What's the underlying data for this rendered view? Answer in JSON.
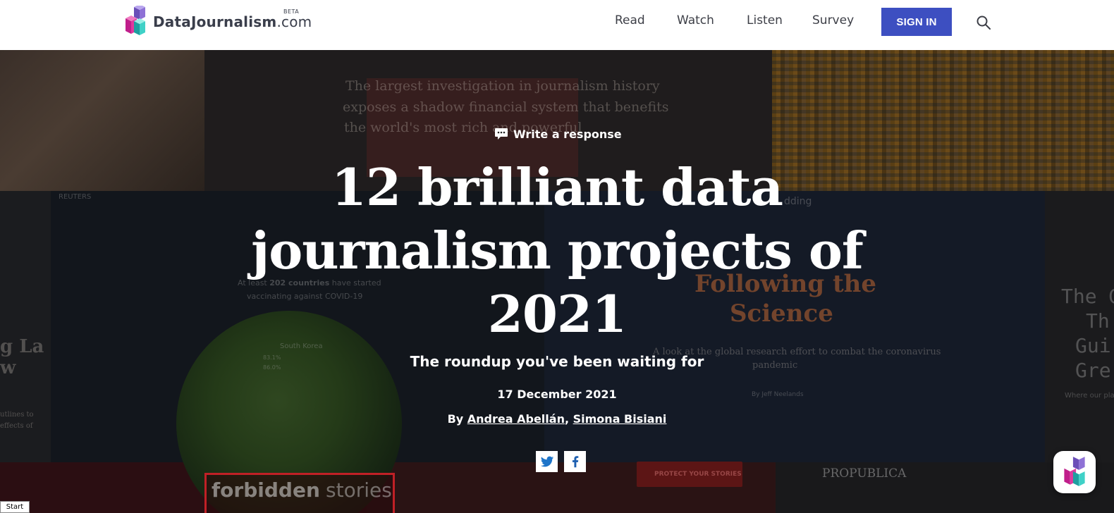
{
  "header": {
    "brand_name": "DataJournalism",
    "brand_suffix": ".com",
    "brand_badge": "BETA",
    "nav": [
      {
        "label": "Read"
      },
      {
        "label": "Watch"
      },
      {
        "label": "Listen"
      },
      {
        "label": "Survey"
      }
    ],
    "signin_label": "SIGN IN",
    "search_icon": "search-icon",
    "accent_color": "#3d4fc1"
  },
  "hero": {
    "respond_label": "Write a response",
    "title": "12 brilliant data journalism projects of 2021",
    "subtitle": "The roundup you've been waiting for",
    "date": "17 December 2021",
    "by_label": "By",
    "authors": [
      "Andrea Abellán",
      "Simona Bisiani"
    ],
    "share": [
      {
        "icon": "twitter-icon"
      },
      {
        "icon": "facebook-icon"
      }
    ]
  },
  "background_text": {
    "icij_lines": [
      "The largest investigation in journalism history",
      "exposes a shadow financial system that benefits",
      "the world's most rich and powerful"
    ],
    "reuters": "REUTERS",
    "vacc_line1_a": "At least",
    "vacc_line1_b": "202 countries",
    "vacc_line1_c": "have started",
    "vacc_line2": "vaccinating against COVID-19",
    "south_korea": "South Korea",
    "sk_pct1": "83.1%",
    "sk_pct2": "86.0%",
    "science_title_1": "Following the",
    "science_title_2": "Science",
    "science_sub_1": "A look at the global research effort to combat the coronavirus",
    "science_sub_2": "pandemic",
    "science_byline": "By Jeff Neelands",
    "left_big_1": "g La",
    "left_big_2": "w",
    "left_small_1": "utlines to",
    "left_small_2": "effects of",
    "right_big_1": "The G",
    "right_big_2": "Th",
    "right_big_3": "Gui",
    "right_big_4": "Gre",
    "right_small": "Where our pla",
    "forbidden": "forbidden",
    "stories": "stories",
    "protect": "PROTECT YOUR STORIES",
    "propublica": "PROPUBLICA",
    "edding": "dding"
  },
  "footer": {
    "start_label": "Start"
  }
}
